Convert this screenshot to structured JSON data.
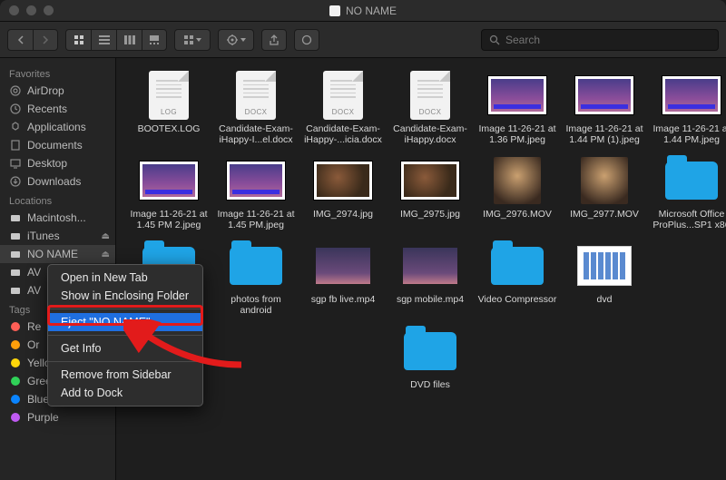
{
  "window": {
    "title": "NO NAME"
  },
  "toolbar": {
    "search_placeholder": "Search"
  },
  "sidebar": {
    "groups": [
      {
        "header": "Favorites",
        "items": [
          {
            "label": "AirDrop",
            "icon": "airdrop-icon"
          },
          {
            "label": "Recents",
            "icon": "clock-icon"
          },
          {
            "label": "Applications",
            "icon": "apps-icon"
          },
          {
            "label": "Documents",
            "icon": "doc-icon"
          },
          {
            "label": "Desktop",
            "icon": "desktop-icon"
          },
          {
            "label": "Downloads",
            "icon": "downloads-icon"
          }
        ]
      },
      {
        "header": "Locations",
        "items": [
          {
            "label": "Macintosh...",
            "icon": "disk-icon"
          },
          {
            "label": "iTunes",
            "icon": "disk-icon",
            "ejectable": true
          },
          {
            "label": "NO NAME",
            "icon": "disk-icon",
            "ejectable": true,
            "selected": true
          },
          {
            "label": "AV",
            "icon": "disk-icon",
            "ejectable": true
          },
          {
            "label": "AV",
            "icon": "disk-icon",
            "ejectable": true
          }
        ]
      },
      {
        "header": "Tags",
        "items": [
          {
            "label": "Re",
            "color": "#ff5f57"
          },
          {
            "label": "Or",
            "color": "#ff9f0a"
          },
          {
            "label": "Yellow",
            "color": "#ffd60a"
          },
          {
            "label": "Green",
            "color": "#30d158"
          },
          {
            "label": "Blue",
            "color": "#0a84ff"
          },
          {
            "label": "Purple",
            "color": "#bf5af2"
          }
        ]
      }
    ]
  },
  "files": [
    {
      "name": "BOOTEX.LOG",
      "kind": "doc",
      "ext": "LOG"
    },
    {
      "name": "Candidate-Exam-iHappy-I...el.docx",
      "kind": "doc",
      "ext": "DOCX"
    },
    {
      "name": "Candidate-Exam-iHappy-...icia.docx",
      "kind": "doc",
      "ext": "DOCX"
    },
    {
      "name": "Candidate-Exam-iHappy.docx",
      "kind": "doc",
      "ext": "DOCX"
    },
    {
      "name": "Image 11-26-21 at 1.36 PM.jpeg",
      "kind": "img-purple"
    },
    {
      "name": "Image 11-26-21 at 1.44 PM (1).jpeg",
      "kind": "img-purple"
    },
    {
      "name": "Image 11-26-21 at 1.44 PM.jpeg",
      "kind": "img-purple"
    },
    {
      "name": "Image 11-26-21 at 1.45 PM 2.jpeg",
      "kind": "img-purple"
    },
    {
      "name": "Image 11-26-21 at 1.45 PM.jpeg",
      "kind": "img-purple"
    },
    {
      "name": "IMG_2974.jpg",
      "kind": "img-photo"
    },
    {
      "name": "IMG_2975.jpg",
      "kind": "img-photo"
    },
    {
      "name": "IMG_2976.MOV",
      "kind": "vid-a"
    },
    {
      "name": "IMG_2977.MOV",
      "kind": "vid-a"
    },
    {
      "name": "Microsoft Office ProPlus...SP1 x86",
      "kind": "folder"
    },
    {
      "name": "",
      "kind": "folder"
    },
    {
      "name": "photos from android",
      "kind": "folder"
    },
    {
      "name": "sgp fb live.mp4",
      "kind": "mp4"
    },
    {
      "name": "sgp mobile.mp4",
      "kind": "mp4"
    },
    {
      "name": "Video Compressor",
      "kind": "folder"
    },
    {
      "name": "dvd",
      "kind": "white"
    },
    {
      "name": "",
      "kind": "blank"
    },
    {
      "name": "",
      "kind": "blank"
    },
    {
      "name": "",
      "kind": "blank"
    },
    {
      "name": "",
      "kind": "blank"
    },
    {
      "name": "DVD files",
      "kind": "folder"
    }
  ],
  "context_menu": {
    "items": [
      {
        "label": "Open in New Tab"
      },
      {
        "label": "Show in Enclosing Folder"
      },
      {
        "sep": true
      },
      {
        "label": "Eject \"NO NAME\"",
        "highlighted": true
      },
      {
        "sep": true
      },
      {
        "label": "Get Info"
      },
      {
        "sep": true
      },
      {
        "label": "Remove from Sidebar"
      },
      {
        "label": "Add to Dock"
      }
    ]
  }
}
